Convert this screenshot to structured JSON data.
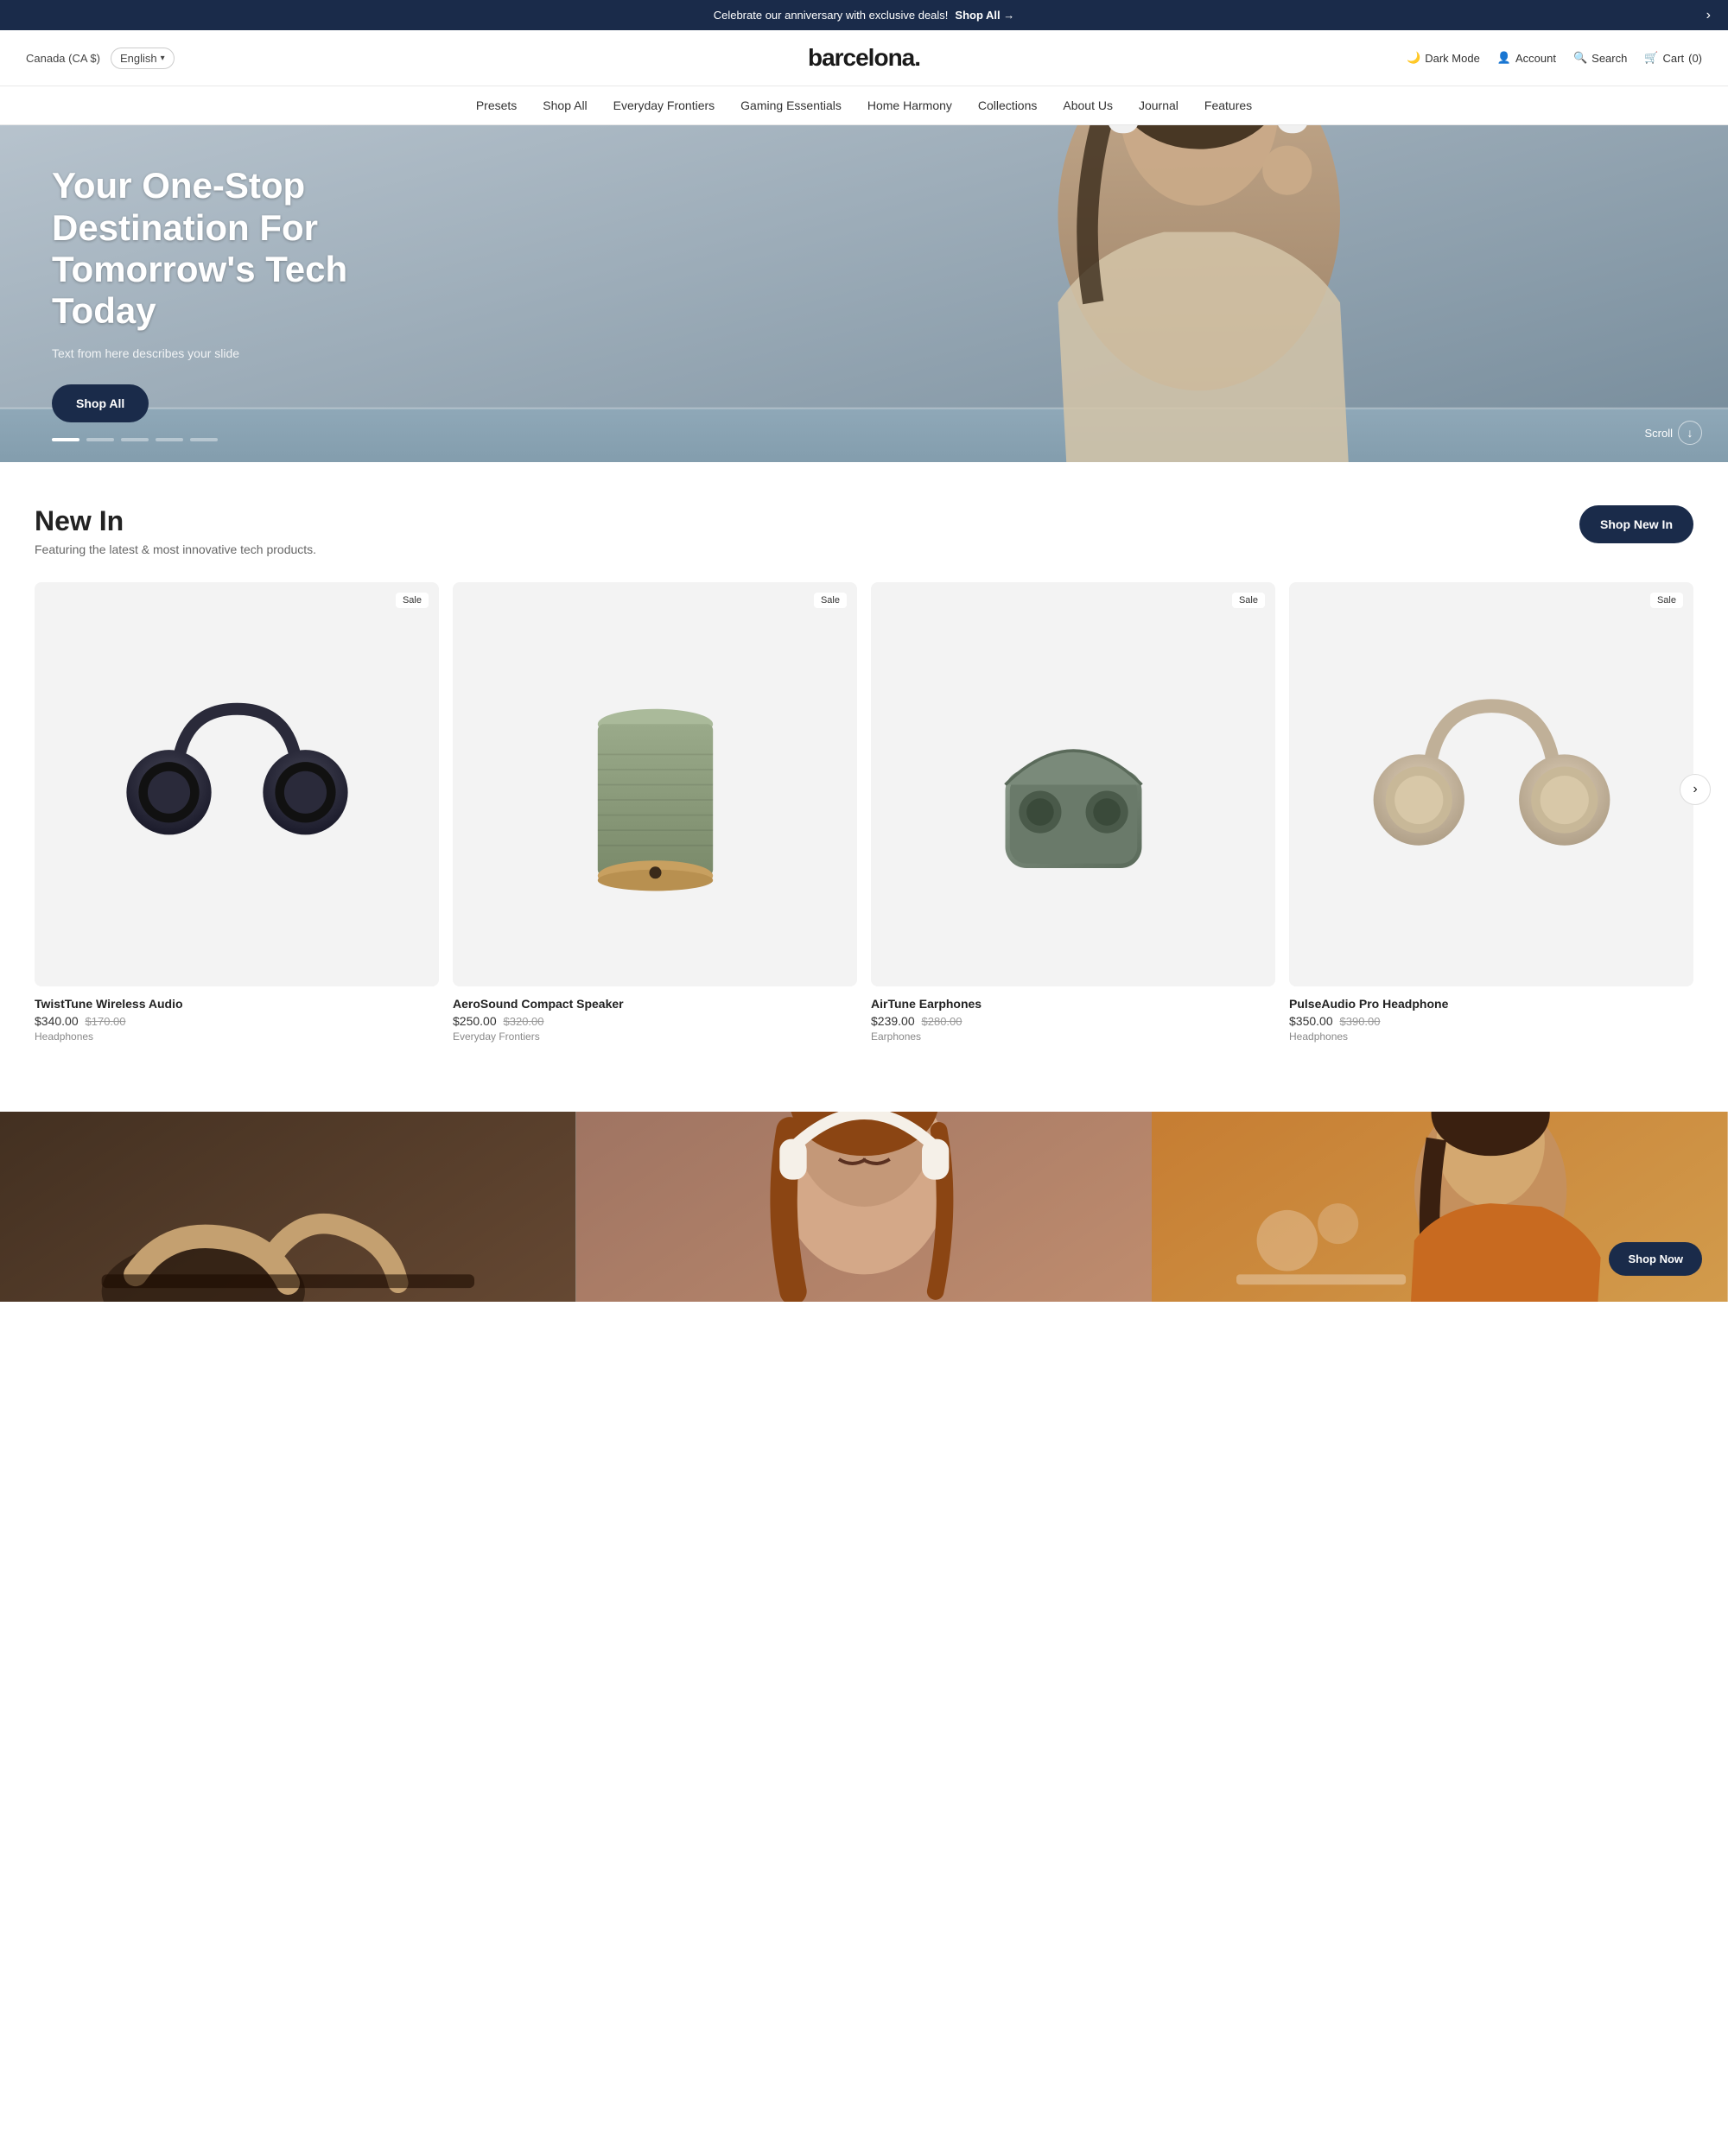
{
  "announcement": {
    "text": "Celebrate our anniversary with exclusive deals!",
    "link_text": "Shop All",
    "arrow": "→",
    "close": "›"
  },
  "header": {
    "region": "Canada (CA $)",
    "language": "English",
    "logo": "barcelona.",
    "dark_mode_label": "Dark Mode",
    "account_label": "Account",
    "search_label": "Search",
    "cart_label": "Cart",
    "cart_count": "(0)"
  },
  "nav": {
    "items": [
      {
        "label": "Presets"
      },
      {
        "label": "Shop All"
      },
      {
        "label": "Everyday Frontiers"
      },
      {
        "label": "Gaming Essentials"
      },
      {
        "label": "Home Harmony"
      },
      {
        "label": "Collections"
      },
      {
        "label": "About Us"
      },
      {
        "label": "Journal"
      },
      {
        "label": "Features"
      }
    ]
  },
  "hero": {
    "title": "Your One-Stop Destination For Tomorrow's Tech Today",
    "subtitle": "Text from here describes your slide",
    "cta_label": "Shop All",
    "scroll_label": "Scroll",
    "dots": [
      1,
      2,
      3,
      4,
      5
    ]
  },
  "new_in": {
    "title": "New In",
    "subtitle": "Featuring the latest & most innovative tech products.",
    "cta_label": "Shop New In",
    "products": [
      {
        "name": "TwistTune Wireless Audio",
        "price": "$340.00",
        "old_price": "$170.00",
        "category": "Headphones",
        "badge": "Sale",
        "color": "#2a2a3a"
      },
      {
        "name": "AeroSound Compact Speaker",
        "price": "$250.00",
        "old_price": "$320.00",
        "category": "Everyday Frontiers",
        "badge": "Sale",
        "color": "#8a9a7a"
      },
      {
        "name": "AirTune Earphones",
        "price": "$239.00",
        "old_price": "$280.00",
        "category": "Earphones",
        "badge": "Sale",
        "color": "#6a7a6a"
      },
      {
        "name": "PulseAudio Pro Headphone",
        "price": "$350.00",
        "old_price": "$390.00",
        "category": "Headphones",
        "badge": "Sale",
        "color": "#c8b89a"
      }
    ]
  },
  "bottom_images": [
    {
      "id": "img1",
      "alt": "Tech lifestyle 1"
    },
    {
      "id": "img2",
      "alt": "Person with headphones"
    },
    {
      "id": "img3",
      "alt": "Tech lifestyle 3"
    }
  ],
  "banners": {
    "shop_now_label": "Shop Now"
  }
}
